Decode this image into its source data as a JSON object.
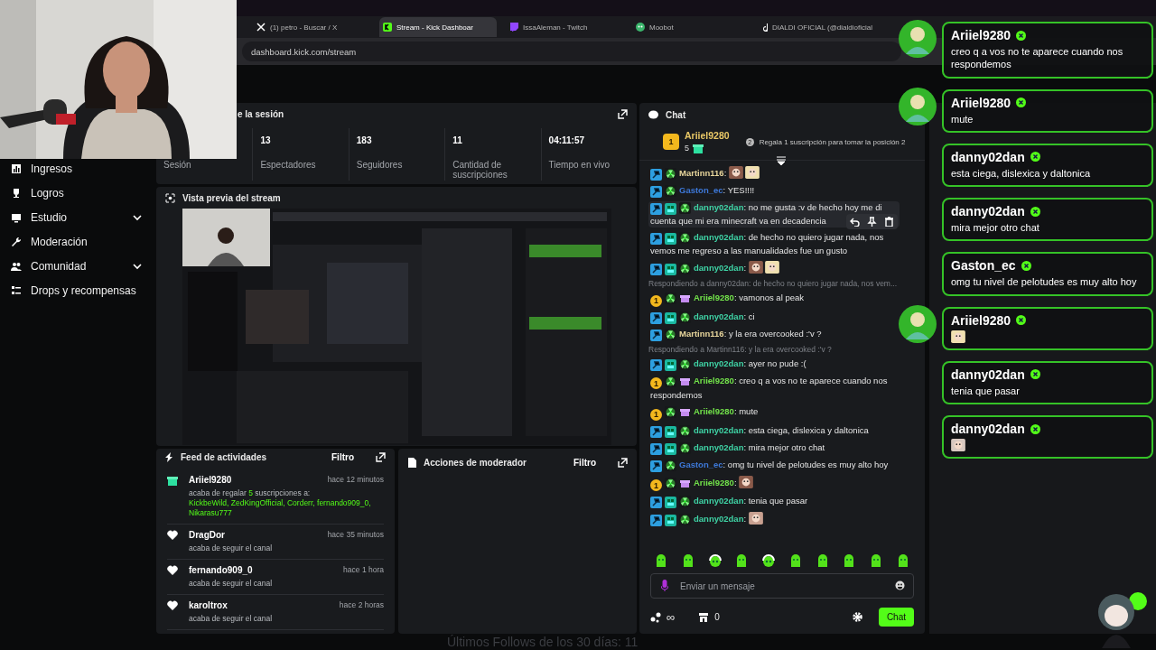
{
  "browser": {
    "tabs": [
      {
        "title": "(1) petro - Buscar / X",
        "selected": false
      },
      {
        "title": "Stream - Kick Dashboar",
        "selected": true
      },
      {
        "title": "IssaAleman - Twitch",
        "selected": false
      },
      {
        "title": "Moobot",
        "selected": false
      },
      {
        "title": "DIALDI OFICIAL (@dialdioficial",
        "selected": false
      }
    ],
    "url": "dashboard.kick.com/stream"
  },
  "webcam": {
    "kind": "picture"
  },
  "sidebar": {
    "items": [
      {
        "label": "Ingresos",
        "expandable": false
      },
      {
        "label": "Logros",
        "expandable": false
      },
      {
        "label": "Estudio",
        "expandable": true
      },
      {
        "label": "Moderación",
        "expandable": false
      },
      {
        "label": "Comunidad",
        "expandable": true
      },
      {
        "label": "Drops y recompensas",
        "expandable": false
      }
    ]
  },
  "session": {
    "title": "e la sesión",
    "stats": [
      {
        "label": "Sesión"
      },
      {
        "value": "13",
        "label": "Espectadores"
      },
      {
        "value": "183",
        "label": "Seguidores"
      },
      {
        "value": "11",
        "label": "Cantidad de suscripciones"
      },
      {
        "value": "04:11:57",
        "label": "Tiempo en vivo"
      }
    ]
  },
  "preview": {
    "title": "Vista previa del stream",
    "frame": {
      "kind": "picture"
    }
  },
  "activity": {
    "title": "Feed de actividades",
    "filter": "Filtro",
    "items": [
      {
        "kind": "gift",
        "user": "Ariiel9280",
        "time": "hace 12 minutos",
        "text": "acaba de regalar",
        "count": "5",
        "text_after": "suscripciones a:",
        "recipients": "KickbeWild, ZedKingOfficial, Corderr, fernando909_0, Nikarasu777"
      },
      {
        "kind": "heart",
        "user": "DragDor",
        "time": "hace 35 minutos",
        "text": "acaba de seguir el canal"
      },
      {
        "kind": "heart",
        "user": "fernando909_0",
        "time": "hace 1 hora",
        "text": "acaba de seguir el canal"
      },
      {
        "kind": "heart",
        "user": "karoltrox",
        "time": "hace 2 horas",
        "text": "acaba de seguir el canal"
      }
    ]
  },
  "moderator": {
    "title": "Acciones de moderador",
    "filter": "Filtro"
  },
  "footer_text": "Últimos Follows de los 30 días: 11",
  "chat": {
    "title": "Chat",
    "leader": {
      "rank": "1",
      "user": "Ariiel9280",
      "gifts": "5",
      "hint_rank": "2",
      "hint": "Regala 1 suscripción para tomar la posición 2"
    },
    "messages": [
      {
        "kind": "message",
        "badges": [
          {
            "kind": "mod"
          },
          {
            "kind": "rad"
          }
        ],
        "user": "Martinn116",
        "color": "#e8d69c",
        "text": ":",
        "emotes": [
          {
            "kind": "picture"
          },
          {
            "kind": "picture"
          }
        ],
        "hovered": false
      },
      {
        "kind": "message",
        "badges": [
          {
            "kind": "mod"
          },
          {
            "kind": "rad"
          }
        ],
        "user": "Gaston_ec",
        "color": "#3d78d8",
        "text": ": YES!!!!",
        "hovered": false
      },
      {
        "kind": "message",
        "badges": [
          {
            "kind": "mod"
          },
          {
            "kind": "og"
          },
          {
            "kind": "rad"
          }
        ],
        "user": "danny02dan",
        "color": "#3fd4a6",
        "text": ": no me gusta :v de hecho hoy me di cuenta que mi era minecraft va en decadencia",
        "hovered": true
      },
      {
        "kind": "message",
        "badges": [
          {
            "kind": "mod"
          },
          {
            "kind": "og"
          },
          {
            "kind": "rad"
          }
        ],
        "user": "danny02dan",
        "color": "#3fd4a6",
        "text": ": de hecho no quiero jugar nada, nos vemos me regreso a las manualidades fue un gusto",
        "hovered": false
      },
      {
        "kind": "message",
        "badges": [
          {
            "kind": "mod"
          },
          {
            "kind": "og"
          },
          {
            "kind": "rad"
          }
        ],
        "user": "danny02dan",
        "color": "#3fd4a6",
        "text": ":",
        "emotes": [
          {
            "kind": "picture"
          },
          {
            "kind": "picture"
          }
        ],
        "hovered": false
      },
      {
        "kind": "reply",
        "text": "Respondiendo a danny02dan: de hecho no quiero jugar nada, nos vem..."
      },
      {
        "kind": "message",
        "badges": [
          {
            "kind": "sub",
            "label": "1"
          },
          {
            "kind": "rad"
          },
          {
            "kind": "gift"
          }
        ],
        "user": "Ariiel9280",
        "color": "#72e24a",
        "text": ": vamonos al peak",
        "hovered": false
      },
      {
        "kind": "message",
        "badges": [
          {
            "kind": "mod"
          },
          {
            "kind": "og"
          },
          {
            "kind": "rad"
          }
        ],
        "user": "danny02dan",
        "color": "#3fd4a6",
        "text": ": ci",
        "hovered": false
      },
      {
        "kind": "message",
        "badges": [
          {
            "kind": "mod"
          },
          {
            "kind": "rad"
          }
        ],
        "user": "Martinn116",
        "color": "#e8d69c",
        "text": ": y la era overcooked :'v ?",
        "hovered": false
      },
      {
        "kind": "reply",
        "text": "Respondiendo a Martinn116: y la era overcooked :'v ?"
      },
      {
        "kind": "message",
        "badges": [
          {
            "kind": "mod"
          },
          {
            "kind": "og"
          },
          {
            "kind": "rad"
          }
        ],
        "user": "danny02dan",
        "color": "#3fd4a6",
        "text": ": ayer no pude :(",
        "hovered": false
      },
      {
        "kind": "message",
        "badges": [
          {
            "kind": "sub",
            "label": "1"
          },
          {
            "kind": "rad"
          },
          {
            "kind": "gift"
          }
        ],
        "user": "Ariiel9280",
        "color": "#72e24a",
        "text": ": creo q a vos no te aparece cuando nos respondemos",
        "hovered": false
      },
      {
        "kind": "message",
        "badges": [
          {
            "kind": "sub",
            "label": "1"
          },
          {
            "kind": "rad"
          },
          {
            "kind": "gift"
          }
        ],
        "user": "Ariiel9280",
        "color": "#72e24a",
        "text": ": mute",
        "hovered": false
      },
      {
        "kind": "message",
        "badges": [
          {
            "kind": "mod"
          },
          {
            "kind": "og"
          },
          {
            "kind": "rad"
          }
        ],
        "user": "danny02dan",
        "color": "#3fd4a6",
        "text": ": esta ciega, dislexica y daltonica",
        "hovered": false
      },
      {
        "kind": "message",
        "badges": [
          {
            "kind": "mod"
          },
          {
            "kind": "og"
          },
          {
            "kind": "rad"
          }
        ],
        "user": "danny02dan",
        "color": "#3fd4a6",
        "text": ": mira mejor otro chat",
        "hovered": false
      },
      {
        "kind": "message",
        "badges": [
          {
            "kind": "mod"
          },
          {
            "kind": "rad"
          }
        ],
        "user": "Gaston_ec",
        "color": "#3d78d8",
        "text": ": omg tu nivel de pelotudes es muy alto hoy",
        "hovered": false
      },
      {
        "kind": "message",
        "badges": [
          {
            "kind": "sub",
            "label": "1"
          },
          {
            "kind": "rad"
          },
          {
            "kind": "gift"
          }
        ],
        "user": "Ariiel9280",
        "color": "#72e24a",
        "text": ":",
        "emotes": [
          {
            "kind": "picture"
          }
        ],
        "hovered": false
      },
      {
        "kind": "message",
        "badges": [
          {
            "kind": "mod"
          },
          {
            "kind": "og"
          },
          {
            "kind": "rad"
          }
        ],
        "user": "danny02dan",
        "color": "#3fd4a6",
        "text": ": tenia que pasar",
        "hovered": false
      },
      {
        "kind": "message",
        "badges": [
          {
            "kind": "mod"
          },
          {
            "kind": "og"
          },
          {
            "kind": "rad"
          }
        ],
        "user": "danny02dan",
        "color": "#3fd4a6",
        "text": ":",
        "emotes": [
          {
            "kind": "picture"
          }
        ],
        "hovered": false
      }
    ],
    "emote_bar": [
      {
        "kind": "blob"
      },
      {
        "kind": "blob"
      },
      {
        "kind": "headset"
      },
      {
        "kind": "blob"
      },
      {
        "kind": "headset"
      },
      {
        "kind": "blob"
      },
      {
        "kind": "blob"
      },
      {
        "kind": "blob"
      },
      {
        "kind": "blob"
      },
      {
        "kind": "blob"
      }
    ],
    "input": {
      "placeholder": "Enviar un mensaje"
    },
    "points": "∞",
    "store": "0",
    "send": "Chat"
  },
  "alerts": [
    {
      "user": "Ariiel9280",
      "text": "creo q a vos no te aparece cuando nos respondemos",
      "avatar": true
    },
    {
      "user": "Ariiel9280",
      "text": "mute",
      "avatar": true
    },
    {
      "user": "danny02dan",
      "text": "esta ciega, dislexica y daltonica",
      "avatar": false
    },
    {
      "user": "danny02dan",
      "text": "mira mejor otro chat",
      "avatar": false
    },
    {
      "user": "Gaston_ec",
      "text": "omg tu nivel de pelotudes es muy alto hoy",
      "avatar": false
    },
    {
      "user": "Ariiel9280",
      "emote": true,
      "avatar": true
    },
    {
      "user": "danny02dan",
      "text": "tenia que pasar",
      "avatar": false
    },
    {
      "user": "danny02dan",
      "emote": true,
      "avatar": false
    }
  ]
}
